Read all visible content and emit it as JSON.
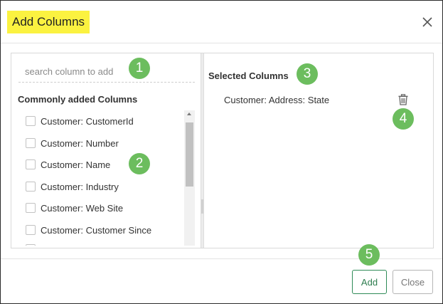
{
  "dialog": {
    "title": "Add Columns",
    "close_icon": "close-icon"
  },
  "search": {
    "placeholder": "search column to add",
    "value": ""
  },
  "available": {
    "title": "Commonly added Columns",
    "items": [
      {
        "label": "Customer: CustomerId",
        "checked": false
      },
      {
        "label": "Customer: Number",
        "checked": false
      },
      {
        "label": "Customer: Name",
        "checked": false
      },
      {
        "label": "Customer: Industry",
        "checked": false
      },
      {
        "label": "Customer: Web Site",
        "checked": false
      },
      {
        "label": "Customer: Customer Since",
        "checked": false
      }
    ]
  },
  "selected": {
    "title": "Selected Columns",
    "items": [
      {
        "label": "Customer: Address: State",
        "icon": "trash-icon"
      }
    ]
  },
  "buttons": {
    "add": "Add",
    "close": "Close"
  },
  "annotations": [
    "1",
    "2",
    "3",
    "4",
    "5"
  ],
  "colors": {
    "title_highlight": "#fbf240",
    "badge": "#6cbd5e",
    "add_button": "#2e8b57"
  }
}
